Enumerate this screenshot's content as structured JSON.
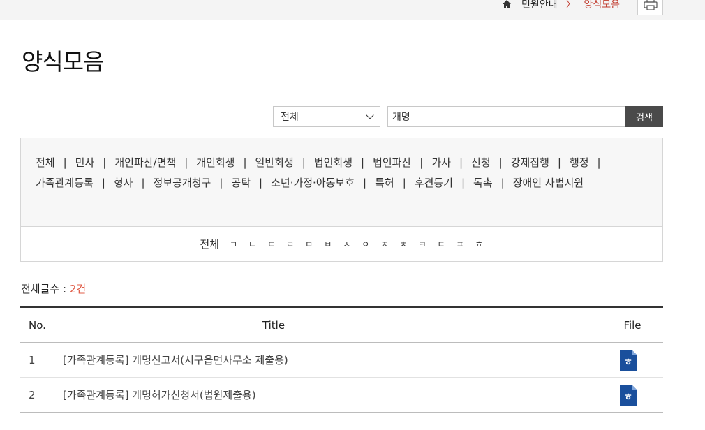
{
  "breadcrumb": {
    "parent": "민원안내",
    "separator": "〉",
    "current": "양식모음"
  },
  "page_title": "양식모음",
  "search": {
    "select_value": "전체",
    "input_value": "개명",
    "button_label": "검색"
  },
  "categories": [
    "전체",
    "민사",
    "개인파산/면책",
    "개인회생",
    "일반회생",
    "법인회생",
    "법인파산",
    "가사",
    "신청",
    "강제집행",
    "행정",
    "가족관계등록",
    "형사",
    "정보공개청구",
    "공탁",
    "소년·가정·아동보호",
    "특허",
    "후견등기",
    "독촉",
    "장애인 사법지원"
  ],
  "category_separator": "|",
  "consonants": [
    "전체",
    "ㄱ",
    "ㄴ",
    "ㄷ",
    "ㄹ",
    "ㅁ",
    "ㅂ",
    "ㅅ",
    "ㅇ",
    "ㅈ",
    "ㅊ",
    "ㅋ",
    "ㅌ",
    "ㅍ",
    "ㅎ"
  ],
  "count": {
    "label": "전체글수 : ",
    "value": "2건"
  },
  "table": {
    "headers": {
      "no": "No.",
      "title": "Title",
      "file": "File"
    },
    "rows": [
      {
        "no": "1",
        "title": "[가족관계등록] 개명신고서(시구읍면사무소 제출용)",
        "file_icon": "hwp-file-icon"
      },
      {
        "no": "2",
        "title": "[가족관계등록] 개명허가신청서(법원제출용)",
        "file_icon": "hwp-file-icon"
      }
    ]
  },
  "colors": {
    "accent": "#c0392b",
    "count_number": "#e05c47",
    "search_button": "#4a4a4a",
    "file_icon": "#1a4f9c"
  }
}
